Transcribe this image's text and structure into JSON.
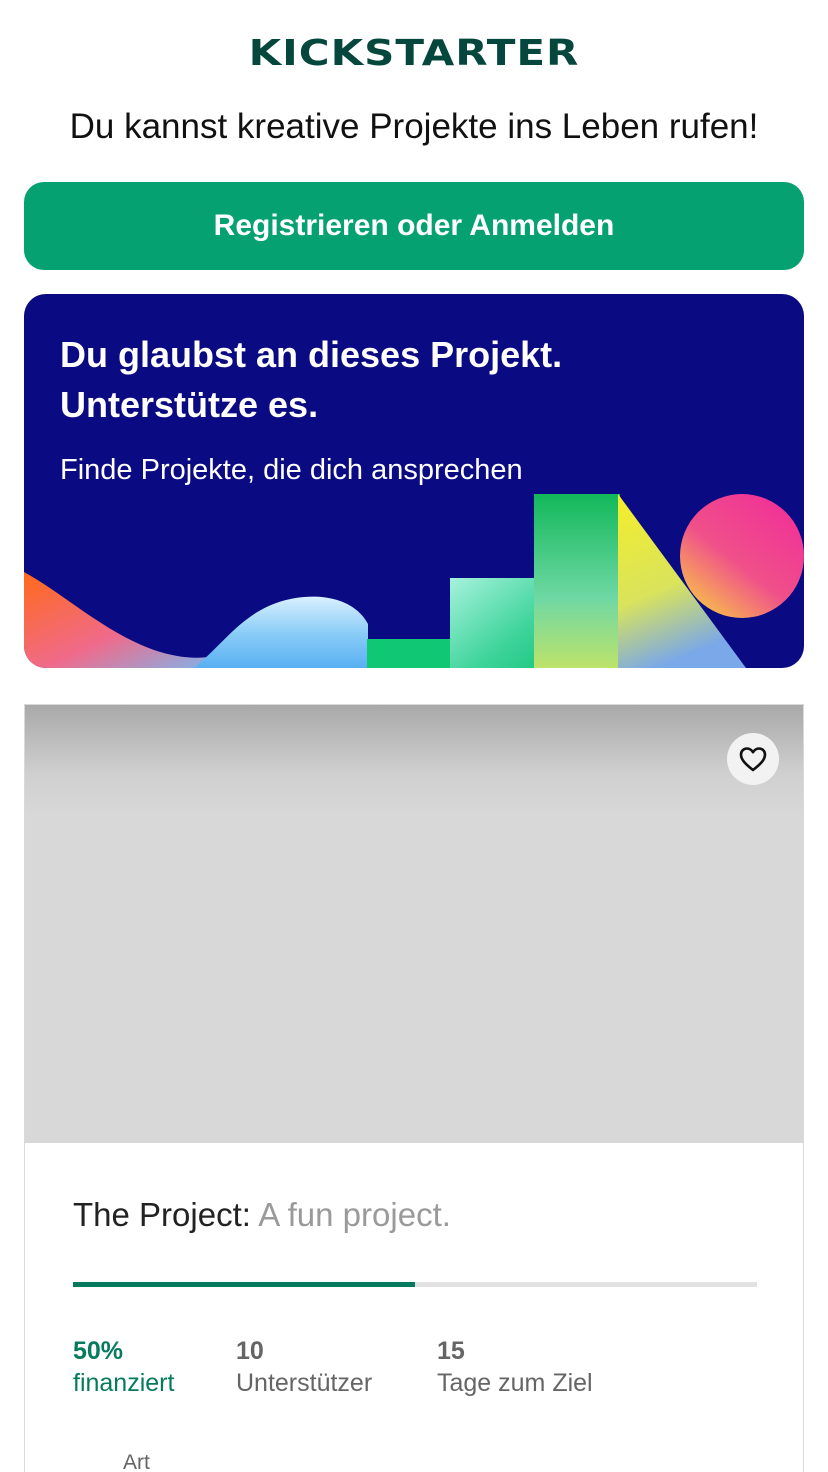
{
  "header": {
    "logo_text": "KICKSTARTER",
    "tagline": "Du kannst kreative Projekte ins Leben rufen!"
  },
  "cta": {
    "label": "Registrieren oder Anmelden"
  },
  "promo": {
    "title": "Du glaubst an dieses Projekt. Unterstütze es.",
    "subtitle": "Finde Projekte, die dich ansprechen"
  },
  "project": {
    "name": "The Project:",
    "blurb": "A fun project.",
    "funded_fraction": 0.5,
    "stats": [
      {
        "value": "50%",
        "label": "finanziert"
      },
      {
        "value": "10",
        "label": "Unterstützer"
      },
      {
        "value": "15",
        "label": "Tage zum Ziel"
      }
    ],
    "category": "Art"
  },
  "icons": {
    "favorite": "heart-icon"
  },
  "colors": {
    "brand_green": "#05a171",
    "logo": "#05473c",
    "promo_background": "#0a0a82",
    "progress": "#067a5d"
  }
}
